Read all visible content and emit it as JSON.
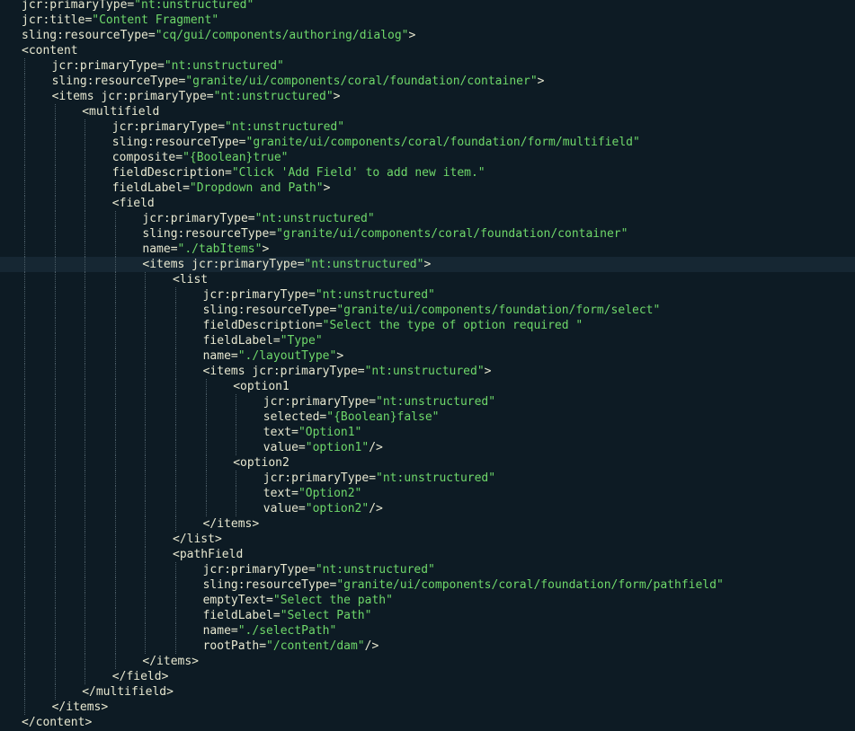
{
  "colors": {
    "background": "#0d1b24",
    "active_line": "#162733",
    "plain_text": "#e8e8d0",
    "string_value": "#6fd86a",
    "indent_guide": "#4c5e68"
  },
  "active_line": 17,
  "lines": [
    {
      "indent": 0,
      "pre": "jcr:primaryType=",
      "val": "\"nt:unstructured\"",
      "post": ""
    },
    {
      "indent": 0,
      "pre": "jcr:title=",
      "val": "\"Content Fragment\"",
      "post": ""
    },
    {
      "indent": 0,
      "pre": "sling:resourceType=",
      "val": "\"cq/gui/components/authoring/dialog\"",
      "post": ">"
    },
    {
      "indent": 0,
      "pre": "<content",
      "val": "",
      "post": ""
    },
    {
      "indent": 1,
      "pre": "jcr:primaryType=",
      "val": "\"nt:unstructured\"",
      "post": ""
    },
    {
      "indent": 1,
      "pre": "sling:resourceType=",
      "val": "\"granite/ui/components/coral/foundation/container\"",
      "post": ">"
    },
    {
      "indent": 1,
      "pre": "<items jcr:primaryType=",
      "val": "\"nt:unstructured\"",
      "post": ">"
    },
    {
      "indent": 2,
      "pre": "<multifield",
      "val": "",
      "post": ""
    },
    {
      "indent": 3,
      "pre": "jcr:primaryType=",
      "val": "\"nt:unstructured\"",
      "post": ""
    },
    {
      "indent": 3,
      "pre": "sling:resourceType=",
      "val": "\"granite/ui/components/coral/foundation/form/multifield\"",
      "post": ""
    },
    {
      "indent": 3,
      "pre": "composite=",
      "val": "\"{Boolean}true\"",
      "post": ""
    },
    {
      "indent": 3,
      "pre": "fieldDescription=",
      "val": "\"Click 'Add Field' to add new item.\"",
      "post": ""
    },
    {
      "indent": 3,
      "pre": "fieldLabel=",
      "val": "\"Dropdown and Path\"",
      "post": ">"
    },
    {
      "indent": 3,
      "pre": "<field",
      "val": "",
      "post": ""
    },
    {
      "indent": 4,
      "pre": "jcr:primaryType=",
      "val": "\"nt:unstructured\"",
      "post": ""
    },
    {
      "indent": 4,
      "pre": "sling:resourceType=",
      "val": "\"granite/ui/components/coral/foundation/container\"",
      "post": ""
    },
    {
      "indent": 4,
      "pre": "name=",
      "val": "\"./tabItems\"",
      "post": ">"
    },
    {
      "indent": 4,
      "pre": "<items jcr:primaryType=",
      "val": "\"nt:unstructured\"",
      "post": ">"
    },
    {
      "indent": 5,
      "pre": "<list",
      "val": "",
      "post": ""
    },
    {
      "indent": 6,
      "pre": "jcr:primaryType=",
      "val": "\"nt:unstructured\"",
      "post": ""
    },
    {
      "indent": 6,
      "pre": "sling:resourceType=",
      "val": "\"granite/ui/components/foundation/form/select\"",
      "post": ""
    },
    {
      "indent": 6,
      "pre": "fieldDescription=",
      "val": "\"Select the type of option required \"",
      "post": ""
    },
    {
      "indent": 6,
      "pre": "fieldLabel=",
      "val": "\"Type\"",
      "post": ""
    },
    {
      "indent": 6,
      "pre": "name=",
      "val": "\"./layoutType\"",
      "post": ">"
    },
    {
      "indent": 6,
      "pre": "<items jcr:primaryType=",
      "val": "\"nt:unstructured\"",
      "post": ">"
    },
    {
      "indent": 7,
      "pre": "<option1",
      "val": "",
      "post": ""
    },
    {
      "indent": 8,
      "pre": "jcr:primaryType=",
      "val": "\"nt:unstructured\"",
      "post": ""
    },
    {
      "indent": 8,
      "pre": "selected=",
      "val": "\"{Boolean}false\"",
      "post": ""
    },
    {
      "indent": 8,
      "pre": "text=",
      "val": "\"Option1\"",
      "post": ""
    },
    {
      "indent": 8,
      "pre": "value=",
      "val": "\"option1\"",
      "post": "/>"
    },
    {
      "indent": 7,
      "pre": "<option2",
      "val": "",
      "post": ""
    },
    {
      "indent": 8,
      "pre": "jcr:primaryType=",
      "val": "\"nt:unstructured\"",
      "post": ""
    },
    {
      "indent": 8,
      "pre": "text=",
      "val": "\"Option2\"",
      "post": ""
    },
    {
      "indent": 8,
      "pre": "value=",
      "val": "\"option2\"",
      "post": "/>"
    },
    {
      "indent": 6,
      "pre": "</items>",
      "val": "",
      "post": ""
    },
    {
      "indent": 5,
      "pre": "</list>",
      "val": "",
      "post": ""
    },
    {
      "indent": 5,
      "pre": "<pathField",
      "val": "",
      "post": ""
    },
    {
      "indent": 6,
      "pre": "jcr:primaryType=",
      "val": "\"nt:unstructured\"",
      "post": ""
    },
    {
      "indent": 6,
      "pre": "sling:resourceType=",
      "val": "\"granite/ui/components/coral/foundation/form/pathfield\"",
      "post": ""
    },
    {
      "indent": 6,
      "pre": "emptyText=",
      "val": "\"Select the path\"",
      "post": ""
    },
    {
      "indent": 6,
      "pre": "fieldLabel=",
      "val": "\"Select Path\"",
      "post": ""
    },
    {
      "indent": 6,
      "pre": "name=",
      "val": "\"./selectPath\"",
      "post": ""
    },
    {
      "indent": 6,
      "pre": "rootPath=",
      "val": "\"/content/dam\"",
      "post": "/>"
    },
    {
      "indent": 4,
      "pre": "</items>",
      "val": "",
      "post": ""
    },
    {
      "indent": 3,
      "pre": "</field>",
      "val": "",
      "post": ""
    },
    {
      "indent": 2,
      "pre": "</multifield>",
      "val": "",
      "post": ""
    },
    {
      "indent": 1,
      "pre": "</items>",
      "val": "",
      "post": ""
    },
    {
      "indent": 0,
      "pre": "</content>",
      "val": "",
      "post": ""
    }
  ]
}
